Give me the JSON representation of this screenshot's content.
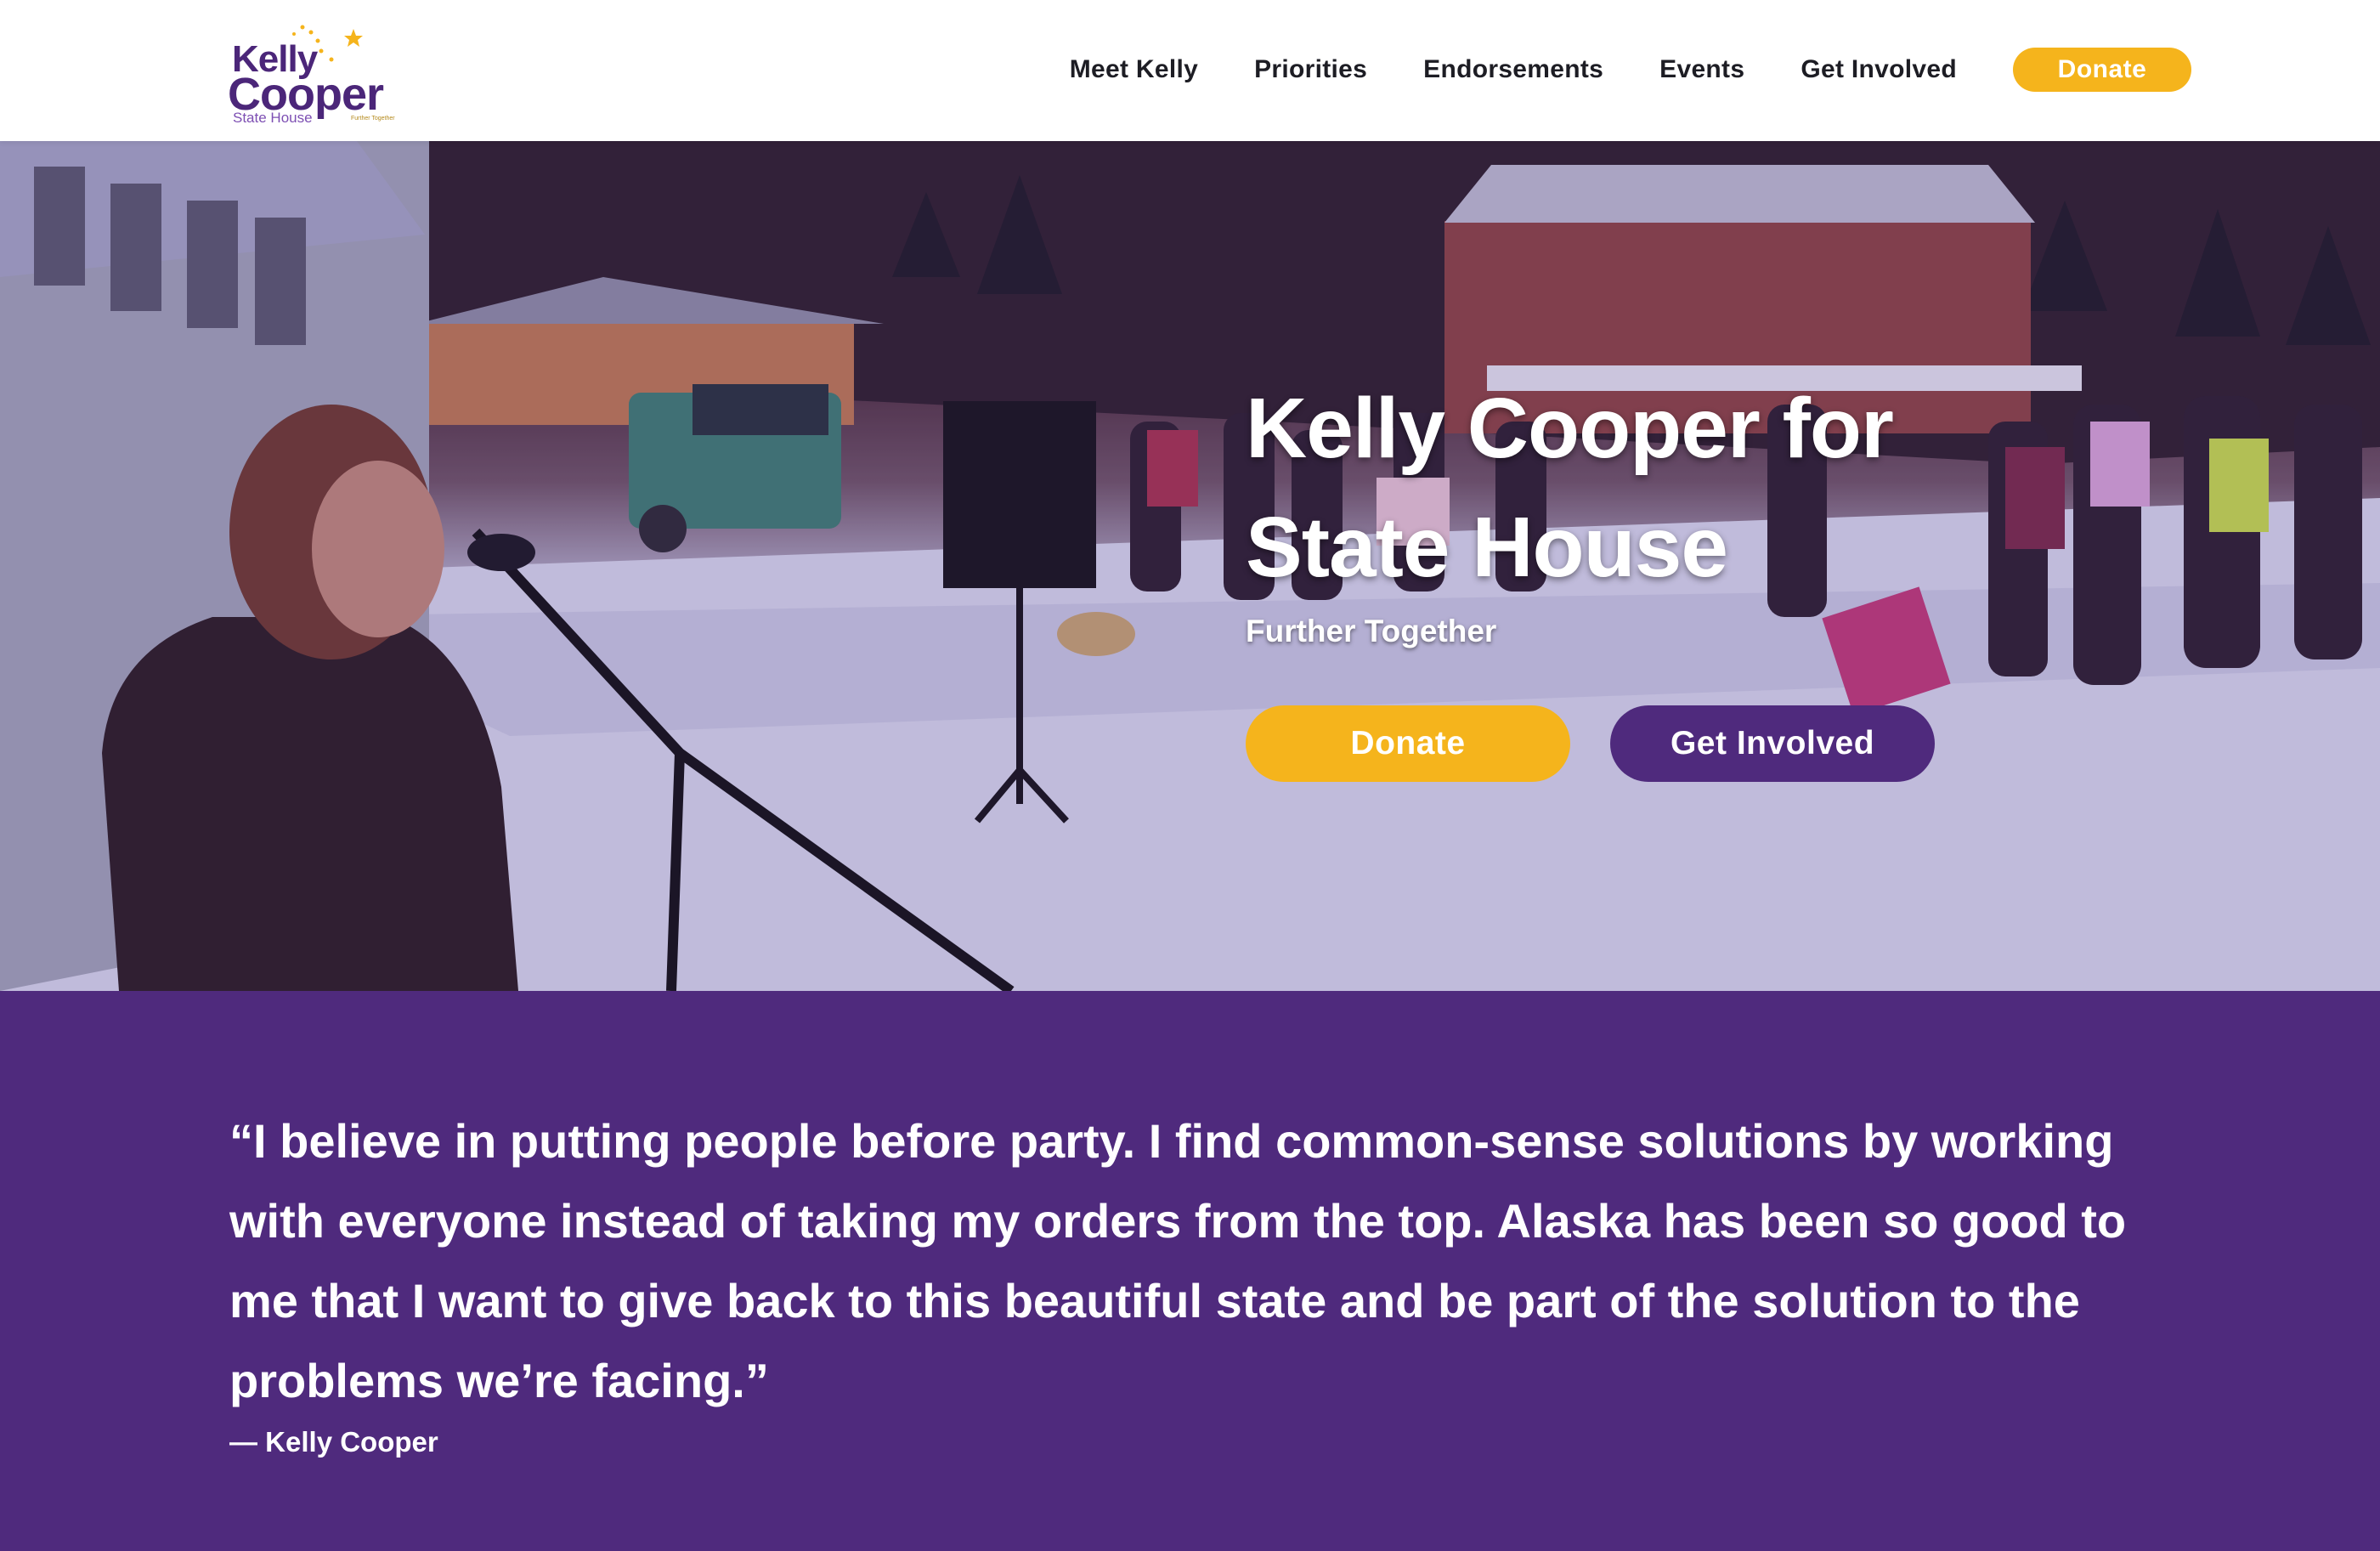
{
  "brand": {
    "logo_line1": "Kelly",
    "logo_line2": "Cooper",
    "logo_subline": "State House",
    "logo_tagline": "Further Together",
    "purple": "#4f2a7d",
    "gold": "#f5b41c"
  },
  "nav": {
    "items": [
      {
        "label": "Meet Kelly"
      },
      {
        "label": "Priorities"
      },
      {
        "label": "Endorsements"
      },
      {
        "label": "Events"
      },
      {
        "label": "Get Involved"
      }
    ],
    "donate_label": "Donate"
  },
  "hero": {
    "title": "Kelly Cooper for State House",
    "subtitle": "Further Together",
    "donate_label": "Donate",
    "involved_label": "Get Involved"
  },
  "quote": {
    "text": "“I believe in putting people before party. I find common-sense solutions by working with everyone instead of taking my orders from the top. Alaska has been so good to me that I want to give back to this beautiful state and be part of the solution to the problems we’re facing.”",
    "attribution": "— Kelly Cooper"
  }
}
